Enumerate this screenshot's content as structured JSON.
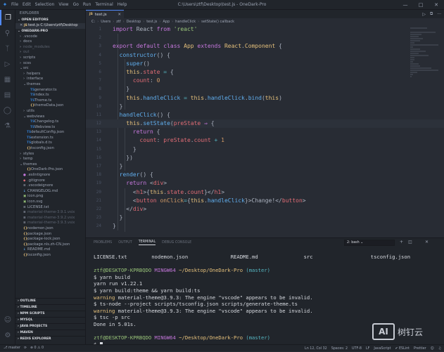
{
  "titlebar": {
    "menu": [
      "File",
      "Edit",
      "Selection",
      "View",
      "Go",
      "Run",
      "Terminal",
      "Help"
    ],
    "title": "C:\\Users\\ztf\\Desktop\\test.js - OneDark-Pro",
    "controls": [
      "—",
      "□",
      "✕"
    ]
  },
  "sidebar": {
    "title": "EXPLORER",
    "open_editors": "OPEN EDITORS",
    "open_file": "test.js  C:\\Users\\ztf\\Desktop",
    "project": "ONEDARK-PRO",
    "tree": [
      {
        "indent": 0,
        "chev": "›",
        "icon": "",
        "label": ".vscode",
        "dim": false
      },
      {
        "indent": 0,
        "chev": "›",
        "icon": "",
        "label": "docs",
        "dim": false
      },
      {
        "indent": 0,
        "chev": "›",
        "icon": "",
        "label": "node_modules",
        "dim": true
      },
      {
        "indent": 0,
        "chev": "›",
        "icon": "",
        "label": "out",
        "dim": true
      },
      {
        "indent": 0,
        "chev": "›",
        "icon": "",
        "label": "scripts",
        "dim": false
      },
      {
        "indent": 0,
        "chev": "›",
        "icon": "",
        "label": "scss",
        "dim": false
      },
      {
        "indent": 0,
        "chev": "⌄",
        "icon": "",
        "label": "src",
        "dim": false
      },
      {
        "indent": 1,
        "chev": "›",
        "icon": "",
        "label": "helpers",
        "dim": false
      },
      {
        "indent": 1,
        "chev": "›",
        "icon": "",
        "label": "interface",
        "dim": false
      },
      {
        "indent": 1,
        "chev": "⌄",
        "icon": "",
        "label": "themes",
        "dim": false
      },
      {
        "indent": 2,
        "chev": "",
        "icon": "TS",
        "label": "generator.ts",
        "dim": false
      },
      {
        "indent": 2,
        "chev": "",
        "icon": "TS",
        "label": "index.ts",
        "dim": false
      },
      {
        "indent": 2,
        "chev": "",
        "icon": "TS",
        "label": "Theme.ts",
        "dim": false
      },
      {
        "indent": 2,
        "chev": "",
        "icon": "{}",
        "label": "themeData.json",
        "dim": false
      },
      {
        "indent": 1,
        "chev": "›",
        "icon": "",
        "label": "utils",
        "dim": false
      },
      {
        "indent": 1,
        "chev": "⌄",
        "icon": "",
        "label": "webviews",
        "dim": false
      },
      {
        "indent": 2,
        "chev": "",
        "icon": "TS",
        "label": "Changelog.ts",
        "dim": false
      },
      {
        "indent": 2,
        "chev": "",
        "icon": "TS",
        "label": "Webview.ts",
        "dim": false
      },
      {
        "indent": 1,
        "chev": "",
        "icon": "TS",
        "label": "defaultConfig.json",
        "dim": false
      },
      {
        "indent": 1,
        "chev": "",
        "icon": "TS",
        "label": "extension.ts",
        "dim": false
      },
      {
        "indent": 1,
        "chev": "",
        "icon": "TS",
        "label": "globals.d.ts",
        "dim": false
      },
      {
        "indent": 1,
        "chev": "",
        "icon": "{}",
        "label": "tsconfig.json",
        "dim": false
      },
      {
        "indent": 0,
        "chev": "›",
        "icon": "",
        "label": "styles",
        "dim": false
      },
      {
        "indent": 0,
        "chev": "›",
        "icon": "",
        "label": "temp",
        "dim": false
      },
      {
        "indent": 0,
        "chev": "⌄",
        "icon": "",
        "label": "themes",
        "dim": false
      },
      {
        "indent": 1,
        "chev": "",
        "icon": "{}",
        "label": "OneDark-Pro.json",
        "dim": false
      },
      {
        "indent": 0,
        "chev": "",
        "icon": "●",
        "label": ".eslintignore",
        "dim": false
      },
      {
        "indent": 0,
        "chev": "",
        "icon": "◆",
        "label": ".gitignore",
        "dim": false
      },
      {
        "indent": 0,
        "chev": "",
        "icon": "≡",
        "label": ".vscodeignore",
        "dim": false
      },
      {
        "indent": 0,
        "chev": "",
        "icon": "↓",
        "label": "CHANGELOG.md",
        "dim": false
      },
      {
        "indent": 0,
        "chev": "",
        "icon": "▣",
        "label": "icon.png",
        "dim": false
      },
      {
        "indent": 0,
        "chev": "",
        "icon": "▣",
        "label": "icon.svg",
        "dim": false
      },
      {
        "indent": 0,
        "chev": "",
        "icon": "≡",
        "label": "LICENSE.txt",
        "dim": false
      },
      {
        "indent": 0,
        "chev": "",
        "icon": "≡",
        "label": "material-theme-3.9.1.vsix",
        "dim": true
      },
      {
        "indent": 0,
        "chev": "",
        "icon": "≡",
        "label": "material-theme-3.9.2.vsix",
        "dim": true
      },
      {
        "indent": 0,
        "chev": "",
        "icon": "≡",
        "label": "material-theme-3.9.3.vsix",
        "dim": true
      },
      {
        "indent": 0,
        "chev": "",
        "icon": "{}",
        "label": "nodemon.json",
        "dim": false
      },
      {
        "indent": 0,
        "chev": "",
        "icon": "{}",
        "label": "package.json",
        "dim": false
      },
      {
        "indent": 0,
        "chev": "",
        "icon": "{}",
        "label": "package-lock.json",
        "dim": false
      },
      {
        "indent": 0,
        "chev": "",
        "icon": "{}",
        "label": "package.nls.zh-CN.json",
        "dim": false
      },
      {
        "indent": 0,
        "chev": "",
        "icon": "↓",
        "label": "README.md",
        "dim": false
      },
      {
        "indent": 0,
        "chev": "",
        "icon": "{}",
        "label": "tsconfig.json",
        "dim": false
      }
    ],
    "bottom_sections": [
      "OUTLINE",
      "TIMELINE",
      "NPM SCRIPTS",
      "MYSQL",
      "JAVA PROJECTS",
      "MAVEN",
      "REDIS EXPLORER"
    ]
  },
  "editor": {
    "tab": {
      "icon": "JS",
      "label": "test.js",
      "close": "✕"
    },
    "tab_actions": [
      "▷",
      "⧉",
      "···"
    ],
    "breadcrumbs": [
      "C:",
      "Users",
      "ztf",
      "Desktop",
      "test.js",
      "App",
      "handleClick",
      "setState() callback"
    ],
    "lines": [
      {
        "n": "1",
        "hl": false,
        "segs": [
          [
            "k",
            "import "
          ],
          [
            "pl",
            "React "
          ],
          [
            "k",
            "from "
          ],
          [
            "s",
            "'react'"
          ]
        ]
      },
      {
        "n": "2",
        "hl": false,
        "segs": []
      },
      {
        "n": "3",
        "hl": false,
        "segs": [
          [
            "k",
            "export default class "
          ],
          [
            "c",
            "App "
          ],
          [
            "k",
            "extends "
          ],
          [
            "c",
            "React"
          ],
          [
            "pl",
            "."
          ],
          [
            "c",
            "Component "
          ],
          [
            "pl",
            "{"
          ]
        ]
      },
      {
        "n": "4",
        "hl": false,
        "segs": [
          [
            "pl",
            "  "
          ],
          [
            "f",
            "constructor"
          ],
          [
            "pl",
            "() {"
          ]
        ]
      },
      {
        "n": "5",
        "hl": false,
        "segs": [
          [
            "pl",
            "    "
          ],
          [
            "f",
            "super"
          ],
          [
            "pl",
            "()"
          ]
        ]
      },
      {
        "n": "6",
        "hl": false,
        "segs": [
          [
            "pl",
            "    "
          ],
          [
            "th",
            "this"
          ],
          [
            "pl",
            "."
          ],
          [
            "p",
            "state "
          ],
          [
            "o",
            "= "
          ],
          [
            "pl",
            "{"
          ]
        ]
      },
      {
        "n": "7",
        "hl": false,
        "segs": [
          [
            "pl",
            "      "
          ],
          [
            "p",
            "count"
          ],
          [
            "pl",
            ": "
          ],
          [
            "n",
            "0"
          ]
        ]
      },
      {
        "n": "8",
        "hl": false,
        "segs": [
          [
            "pl",
            "    }"
          ]
        ]
      },
      {
        "n": "9",
        "hl": false,
        "segs": [
          [
            "pl",
            "    "
          ],
          [
            "th",
            "this"
          ],
          [
            "pl",
            "."
          ],
          [
            "f",
            "handleClick "
          ],
          [
            "o",
            "= "
          ],
          [
            "th",
            "this"
          ],
          [
            "pl",
            "."
          ],
          [
            "f",
            "handleClick"
          ],
          [
            "pl",
            "."
          ],
          [
            "f",
            "bind"
          ],
          [
            "pl",
            "("
          ],
          [
            "th",
            "this"
          ],
          [
            "pl",
            ")"
          ]
        ]
      },
      {
        "n": "10",
        "hl": false,
        "segs": [
          [
            "pl",
            "  }"
          ]
        ]
      },
      {
        "n": "11",
        "hl": false,
        "segs": [
          [
            "pl",
            "  "
          ],
          [
            "f",
            "handleClick"
          ],
          [
            "pl",
            "() {"
          ]
        ]
      },
      {
        "n": "12",
        "hl": true,
        "segs": [
          [
            "pl",
            "    "
          ],
          [
            "th",
            "this"
          ],
          [
            "pl",
            "."
          ],
          [
            "f",
            "setState"
          ],
          [
            "pl",
            "("
          ],
          [
            "p",
            "preState "
          ],
          [
            "k",
            "⇒ "
          ],
          [
            "pl",
            "{"
          ]
        ]
      },
      {
        "n": "13",
        "hl": false,
        "segs": [
          [
            "pl",
            "      "
          ],
          [
            "k",
            "return "
          ],
          [
            "pl",
            "{"
          ]
        ]
      },
      {
        "n": "14",
        "hl": false,
        "segs": [
          [
            "pl",
            "        "
          ],
          [
            "p",
            "count"
          ],
          [
            "pl",
            ": "
          ],
          [
            "p",
            "preState"
          ],
          [
            "pl",
            "."
          ],
          [
            "p",
            "count "
          ],
          [
            "o",
            "+ "
          ],
          [
            "n",
            "1"
          ]
        ]
      },
      {
        "n": "15",
        "hl": false,
        "segs": [
          [
            "pl",
            "      }"
          ]
        ]
      },
      {
        "n": "16",
        "hl": false,
        "segs": [
          [
            "pl",
            "    })"
          ]
        ]
      },
      {
        "n": "17",
        "hl": false,
        "segs": [
          [
            "pl",
            "  }"
          ]
        ]
      },
      {
        "n": "18",
        "hl": false,
        "segs": [
          [
            "pl",
            "  "
          ],
          [
            "f",
            "render"
          ],
          [
            "pl",
            "() {"
          ]
        ]
      },
      {
        "n": "19",
        "hl": false,
        "segs": [
          [
            "pl",
            "    "
          ],
          [
            "k",
            "return "
          ],
          [
            "pl",
            "<"
          ],
          [
            "t",
            "div"
          ],
          [
            "pl",
            ">"
          ]
        ]
      },
      {
        "n": "20",
        "hl": false,
        "segs": [
          [
            "pl",
            "      <"
          ],
          [
            "t",
            "h1"
          ],
          [
            "pl",
            ">{"
          ],
          [
            "th",
            "this"
          ],
          [
            "pl",
            "."
          ],
          [
            "p",
            "state"
          ],
          [
            "pl",
            "."
          ],
          [
            "p",
            "count"
          ],
          [
            "pl",
            "}</"
          ],
          [
            "t",
            "h1"
          ],
          [
            "pl",
            ">"
          ]
        ]
      },
      {
        "n": "21",
        "hl": false,
        "segs": [
          [
            "pl",
            "      <"
          ],
          [
            "t",
            "button "
          ],
          [
            "n",
            "onClick"
          ],
          [
            "o",
            "="
          ],
          [
            "pl",
            "{"
          ],
          [
            "th",
            "this"
          ],
          [
            "pl",
            "."
          ],
          [
            "f",
            "handleClick"
          ],
          [
            "pl",
            "}>Change!</"
          ],
          [
            "t",
            "button"
          ],
          [
            "pl",
            ">"
          ]
        ]
      },
      {
        "n": "22",
        "hl": false,
        "segs": [
          [
            "pl",
            "    </"
          ],
          [
            "t",
            "div"
          ],
          [
            "pl",
            ">"
          ]
        ]
      },
      {
        "n": "23",
        "hl": false,
        "segs": [
          [
            "pl",
            "  }"
          ]
        ]
      },
      {
        "n": "24",
        "hl": false,
        "segs": [
          [
            "pl",
            "}"
          ]
        ]
      }
    ]
  },
  "panel": {
    "tabs": [
      "PROBLEMS",
      "OUTPUT",
      "TERMINAL",
      "DEBUG CONSOLE"
    ],
    "active_tab": "TERMINAL",
    "terminal_select": "2: bash",
    "icons": [
      "+",
      "◫",
      "✕"
    ],
    "terminal_lines": [
      [
        [
          "",
          "LICENSE.txt        nodemon.json              README.md               src                   tsconfig.json"
        ]
      ],
      [
        [
          "",
          ""
        ]
      ],
      [
        [
          "g",
          "ztf@DESKTOP-KPRBQDO "
        ],
        [
          "m",
          "MINGW64 "
        ],
        [
          "y",
          "~/Desktop/OneDark-Pro "
        ],
        [
          "c2",
          "(master)"
        ]
      ],
      [
        [
          "",
          "$ yarn build"
        ]
      ],
      [
        [
          "",
          "yarn run v1.22.1"
        ]
      ],
      [
        [
          "",
          "$ yarn build:theme && yarn build:ts"
        ]
      ],
      [
        [
          "y",
          "warning "
        ],
        [
          "",
          "material-theme@3.9.3: The engine \"vscode\" appears to be invalid."
        ]
      ],
      [
        [
          "",
          "$ ts-node --project scripts/tsconfig.json scripts/generate-theme.ts"
        ]
      ],
      [
        [
          "y",
          "warning "
        ],
        [
          "",
          "material-theme@3.9.3: The engine \"vscode\" appears to be invalid."
        ]
      ],
      [
        [
          "",
          "$ tsc -p src"
        ]
      ],
      [
        [
          "",
          "Done in 5.01s."
        ]
      ],
      [
        [
          "",
          ""
        ]
      ],
      [
        [
          "g",
          "ztf@DESKTOP-KPRBQDO "
        ],
        [
          "m",
          "MINGW64 "
        ],
        [
          "y",
          "~/Desktop/OneDark-Pro "
        ],
        [
          "c2",
          "(master)"
        ]
      ],
      [
        [
          "",
          "$ "
        ]
      ]
    ]
  },
  "statusbar": {
    "left": [
      "⎇ master",
      "⟳",
      "⊗ 0  ⚠ 0"
    ],
    "right": [
      "Ln 12, Col 32",
      "Spaces: 2",
      "UTF-8",
      "LF",
      "JavaScript",
      "✔ ESLint",
      "Prettier",
      "☺",
      "♫"
    ]
  },
  "watermark": {
    "box": "AI",
    "text": "树钉云"
  }
}
